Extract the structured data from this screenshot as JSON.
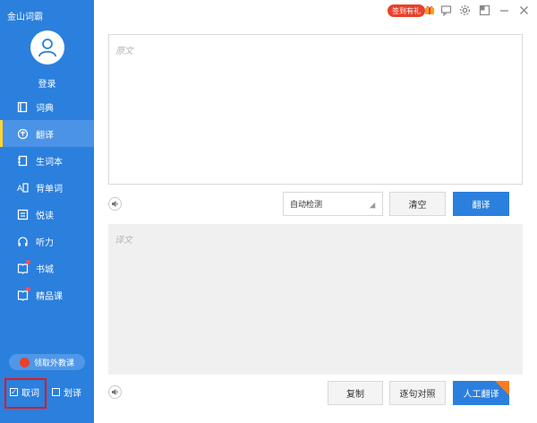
{
  "app": {
    "title": "金山词霸"
  },
  "user": {
    "login_label": "登录"
  },
  "sidebar": {
    "items": [
      {
        "label": "词典",
        "icon": "book-open-icon",
        "active": false,
        "dot": false
      },
      {
        "label": "翻译",
        "icon": "translate-icon",
        "active": true,
        "dot": false
      },
      {
        "label": "生词本",
        "icon": "notebook-icon",
        "active": false,
        "dot": false
      },
      {
        "label": "背单词",
        "icon": "flashcard-icon",
        "active": false,
        "dot": false
      },
      {
        "label": "悦读",
        "icon": "reading-icon",
        "active": false,
        "dot": false
      },
      {
        "label": "听力",
        "icon": "headphones-icon",
        "active": false,
        "dot": false
      },
      {
        "label": "书城",
        "icon": "bookstore-icon",
        "active": false,
        "dot": true
      },
      {
        "label": "精品课",
        "icon": "course-icon",
        "active": false,
        "dot": true
      }
    ],
    "promo_label": "领取外教课",
    "toggles": [
      {
        "label": "取词",
        "checked": true
      },
      {
        "label": "划译",
        "checked": false
      }
    ]
  },
  "topbar": {
    "sign_badge": "签到有礼"
  },
  "source": {
    "placeholder": "原文"
  },
  "controls": {
    "language_select": "自动检测",
    "clear_label": "清空",
    "translate_label": "翻译"
  },
  "target": {
    "placeholder": "译文"
  },
  "bottom": {
    "copy_label": "复制",
    "compare_label": "逐句对照",
    "human_translate_label": "人工翻译"
  },
  "colors": {
    "sidebar": "#2b7fdd",
    "accent": "#2b7fdd",
    "active_indicator": "#ffd633",
    "badge": "#e8412c"
  }
}
